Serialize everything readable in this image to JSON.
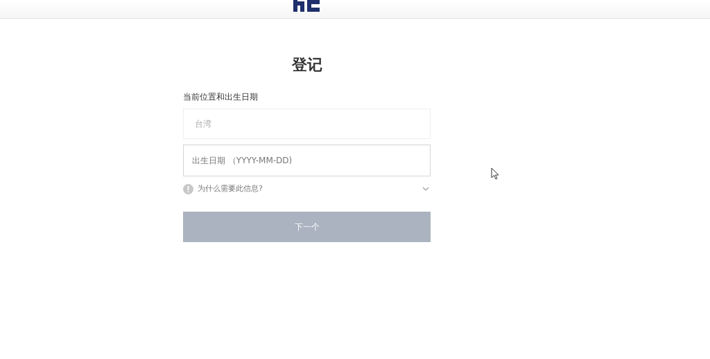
{
  "title": "登记",
  "section_label": "当前位置和出生日期",
  "location_field": {
    "value": "台湾",
    "disabled": true
  },
  "birthdate_field": {
    "placeholder": "出生日期 （YYYY-MM-DD)"
  },
  "info_toggle": {
    "label": "为什么需要此信息?",
    "expanded": false
  },
  "next_button": {
    "label": "下一个",
    "disabled": true
  }
}
